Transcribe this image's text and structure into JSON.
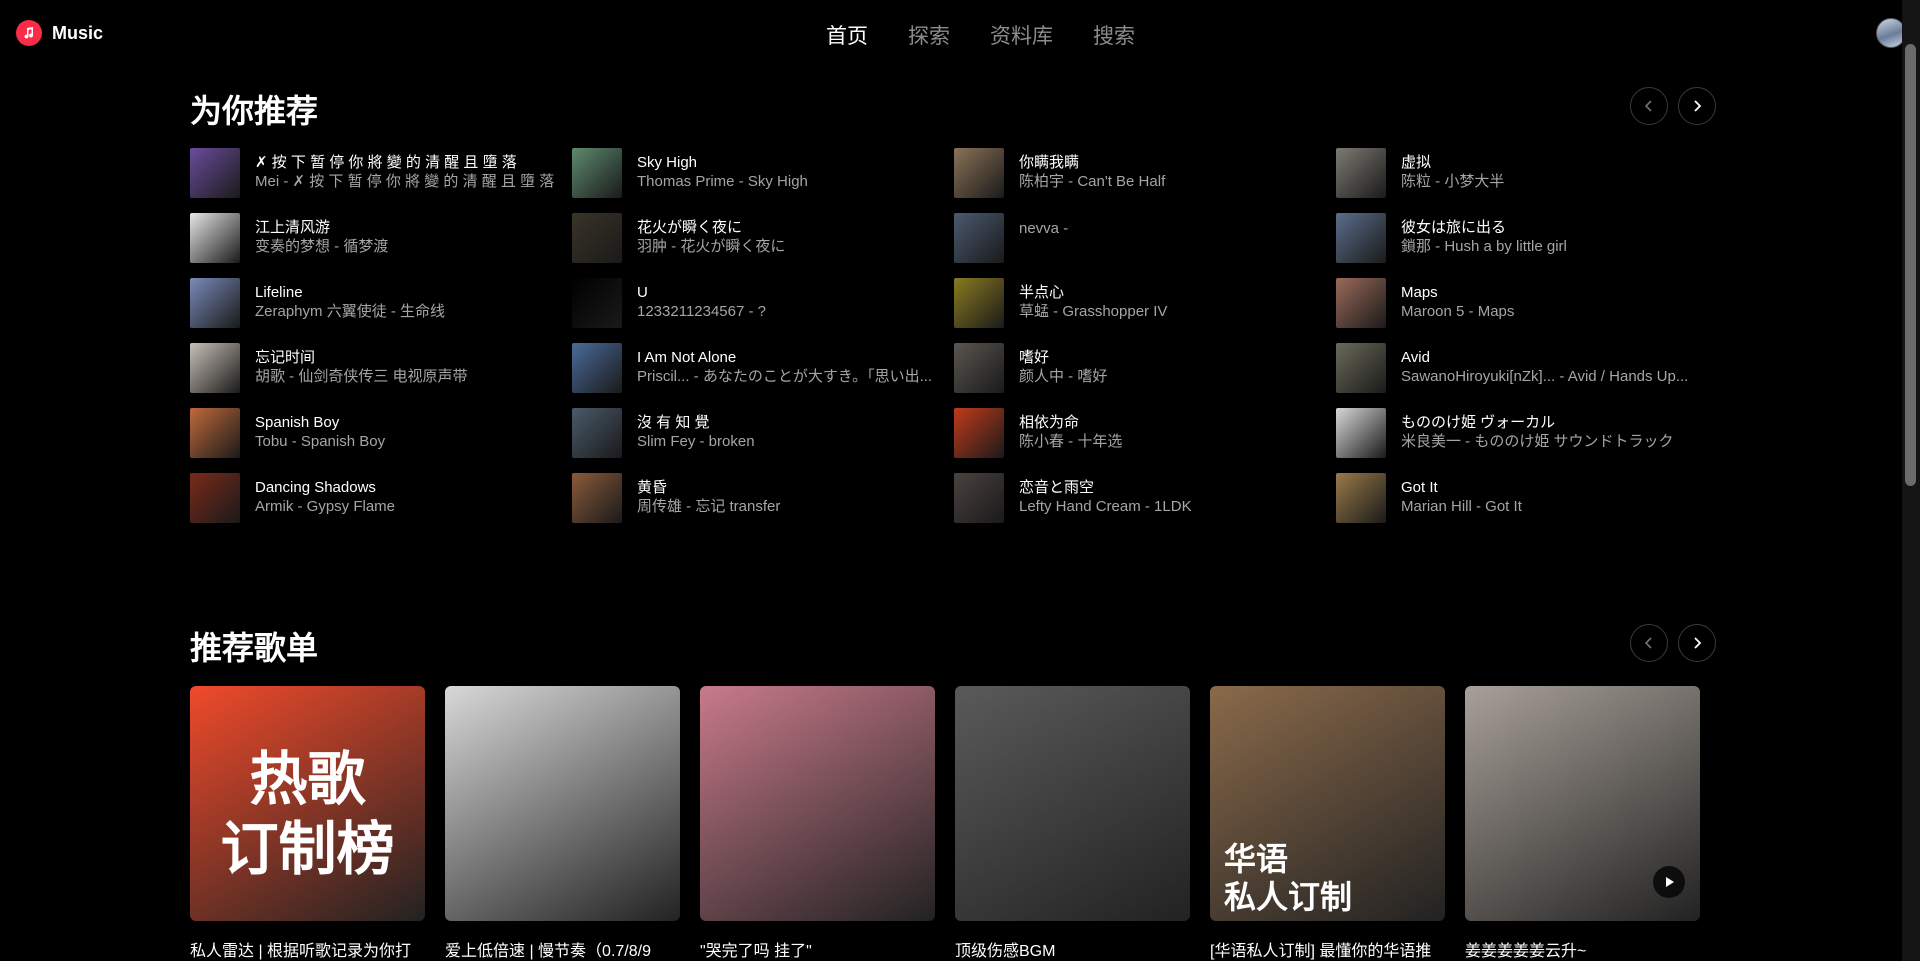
{
  "app": {
    "name": "Music"
  },
  "nav": [
    {
      "label": "首页",
      "active": true
    },
    {
      "label": "探索",
      "active": false
    },
    {
      "label": "资料库",
      "active": false
    },
    {
      "label": "搜索",
      "active": false
    }
  ],
  "recommended": {
    "title": "为你推荐",
    "songs": [
      {
        "title": "✗ 按 下 暂 停 你 將 變 的 清 醒 且 墮 落",
        "subtitle": "Mei - ✗ 按 下 暂 停 你 將 變 的 清 醒 且 墮 落",
        "color": "#6a4c9c"
      },
      {
        "title": "Sky High",
        "subtitle": "Thomas Prime - Sky High",
        "color": "#5d8a6e"
      },
      {
        "title": "你瞒我瞒",
        "subtitle": "陈柏宇 - Can't Be Half",
        "color": "#8a7258"
      },
      {
        "title": "虚拟",
        "subtitle": "陈粒 - 小梦大半",
        "color": "#7d7a72"
      },
      {
        "title": "江上清风游",
        "subtitle": "变奏的梦想 - 循梦渡",
        "color": "#e6e6e6"
      },
      {
        "title": "花火が瞬く夜に",
        "subtitle": "羽肿 - 花火が瞬く夜に",
        "color": "#3a3428"
      },
      {
        "title": "",
        "subtitle": "nevva -",
        "color": "#4a5a70"
      },
      {
        "title": "彼女は旅に出る",
        "subtitle": "鎖那 - Hush a by little girl",
        "color": "#5a6e8a"
      },
      {
        "title": "Lifeline",
        "subtitle": "Zeraphym 六翼使徒 - 生命线",
        "color": "#7a8ab8"
      },
      {
        "title": "U",
        "subtitle": "1233211234567 - ?",
        "color": "#000000"
      },
      {
        "title": "半点心",
        "subtitle": "草蜢 - Grasshopper IV",
        "color": "#8a7a20"
      },
      {
        "title": "Maps",
        "subtitle": "Maroon 5 - Maps",
        "color": "#9a6a5a"
      },
      {
        "title": "忘记时间",
        "subtitle": "胡歌 - 仙剑奇侠传三 电视原声带",
        "color": "#c8c0b8"
      },
      {
        "title": "I Am Not Alone",
        "subtitle": "Priscil... - あなたのことが大すき。「思い出...",
        "color": "#4a6a9a"
      },
      {
        "title": "嗜好",
        "subtitle": "颜人中 - 嗜好",
        "color": "#5a5650"
      },
      {
        "title": "Avid",
        "subtitle": "SawanoHiroyuki[nZk]... - Avid / Hands Up...",
        "color": "#6a6a5a"
      },
      {
        "title": "Spanish Boy",
        "subtitle": "Tobu - Spanish Boy",
        "color": "#c06a3a"
      },
      {
        "title": "沒 有 知 覺",
        "subtitle": "Slim Fey - broken",
        "color": "#4a5a6a"
      },
      {
        "title": "相依为命",
        "subtitle": "陈小春 - 十年选",
        "color": "#c03a1a"
      },
      {
        "title": "もののけ姫 ヴォーカル",
        "subtitle": "米良美一 - もののけ姫 サウンドトラック",
        "color": "#d8d8d8"
      },
      {
        "title": "Dancing Shadows",
        "subtitle": "Armik - Gypsy Flame",
        "color": "#7a2a1a"
      },
      {
        "title": "黄昏",
        "subtitle": "周传雄 - 忘记 transfer",
        "color": "#8a5a3a"
      },
      {
        "title": "恋音と雨空",
        "subtitle": "Lefty Hand Cream - 1LDK",
        "color": "#4a4240"
      },
      {
        "title": "Got It",
        "subtitle": "Marian Hill - Got It",
        "color": "#9a7a4a"
      }
    ]
  },
  "playlists": {
    "title": "推荐歌单",
    "items": [
      {
        "title": "私人雷达 | 根据听歌记录为你打",
        "cover_line1": "热歌",
        "cover_line2": "订制榜",
        "color": "#f04a2a"
      },
      {
        "title": "爱上低倍速 | 慢节奏（0.7/8/9",
        "color": "#d8d8d8"
      },
      {
        "title": "\"哭完了吗 挂了\"",
        "color": "#c87a8a"
      },
      {
        "title": "顶级伤感BGM",
        "color": "#5a5a5a"
      },
      {
        "title": "[华语私人订制] 最懂你的华语推",
        "cover_line1": "华语",
        "cover_line2": "私人订制",
        "color": "#8a6a4a"
      },
      {
        "title": "姜姜姜姜姜云升~",
        "color": "#a8a098"
      }
    ]
  }
}
